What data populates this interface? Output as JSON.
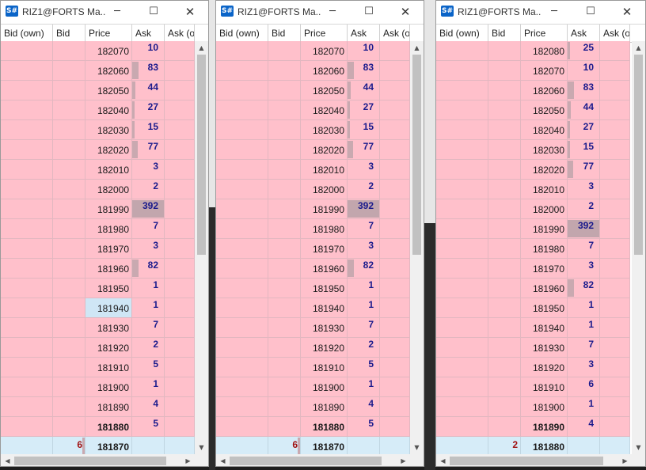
{
  "windows": [
    {
      "title": "RIZ1@FORTS Ma...",
      "columns": [
        "Bid (own)",
        "Bid",
        "Price",
        "Ask",
        "Ask (o"
      ],
      "rows": [
        {
          "price": "182070",
          "ask": "10",
          "askbar": 0
        },
        {
          "price": "182060",
          "ask": "83",
          "askbar": 0.19
        },
        {
          "price": "182050",
          "ask": "44",
          "askbar": 0.1
        },
        {
          "price": "182040",
          "ask": "27",
          "askbar": 0.06
        },
        {
          "price": "182030",
          "ask": "15",
          "askbar": 0.04
        },
        {
          "price": "182020",
          "ask": "77",
          "askbar": 0.18
        },
        {
          "price": "182010",
          "ask": "3",
          "askbar": 0
        },
        {
          "price": "182000",
          "ask": "2",
          "askbar": 0
        },
        {
          "price": "181990",
          "ask": "392",
          "askbar": 1
        },
        {
          "price": "181980",
          "ask": "7",
          "askbar": 0
        },
        {
          "price": "181970",
          "ask": "3",
          "askbar": 0
        },
        {
          "price": "181960",
          "ask": "82",
          "askbar": 0.2
        },
        {
          "price": "181950",
          "ask": "1",
          "askbar": 0
        },
        {
          "price": "181940",
          "ask": "1",
          "askbar": 0,
          "highlight": true
        },
        {
          "price": "181930",
          "ask": "7",
          "askbar": 0
        },
        {
          "price": "181920",
          "ask": "2",
          "askbar": 0
        },
        {
          "price": "181910",
          "ask": "5",
          "askbar": 0
        },
        {
          "price": "181900",
          "ask": "1",
          "askbar": 0
        },
        {
          "price": "181890",
          "ask": "4",
          "askbar": 0
        },
        {
          "price": "181880",
          "ask": "5",
          "askbar": 0,
          "bold": true
        },
        {
          "price": "181870",
          "bid": "6",
          "bidbar": 0.05,
          "bold": true,
          "last": true
        }
      ]
    },
    {
      "title": "RIZ1@FORTS Ma...",
      "columns": [
        "Bid (own)",
        "Bid",
        "Price",
        "Ask",
        "Ask (o"
      ],
      "rows": [
        {
          "price": "182070",
          "ask": "10",
          "askbar": 0
        },
        {
          "price": "182060",
          "ask": "83",
          "askbar": 0.19
        },
        {
          "price": "182050",
          "ask": "44",
          "askbar": 0.1
        },
        {
          "price": "182040",
          "ask": "27",
          "askbar": 0.06
        },
        {
          "price": "182030",
          "ask": "15",
          "askbar": 0.04
        },
        {
          "price": "182020",
          "ask": "77",
          "askbar": 0.18
        },
        {
          "price": "182010",
          "ask": "3",
          "askbar": 0
        },
        {
          "price": "182000",
          "ask": "2",
          "askbar": 0
        },
        {
          "price": "181990",
          "ask": "392",
          "askbar": 1
        },
        {
          "price": "181980",
          "ask": "7",
          "askbar": 0
        },
        {
          "price": "181970",
          "ask": "3",
          "askbar": 0
        },
        {
          "price": "181960",
          "ask": "82",
          "askbar": 0.2
        },
        {
          "price": "181950",
          "ask": "1",
          "askbar": 0
        },
        {
          "price": "181940",
          "ask": "1",
          "askbar": 0
        },
        {
          "price": "181930",
          "ask": "7",
          "askbar": 0
        },
        {
          "price": "181920",
          "ask": "2",
          "askbar": 0
        },
        {
          "price": "181910",
          "ask": "5",
          "askbar": 0
        },
        {
          "price": "181900",
          "ask": "1",
          "askbar": 0
        },
        {
          "price": "181890",
          "ask": "4",
          "askbar": 0
        },
        {
          "price": "181880",
          "ask": "5",
          "askbar": 0,
          "bold": true
        },
        {
          "price": "181870",
          "bid": "6",
          "bidbar": 0.05,
          "bold": true,
          "last": true
        }
      ]
    },
    {
      "title": "RIZ1@FORTS Ma...",
      "columns": [
        "Bid (own)",
        "Bid",
        "Price",
        "Ask",
        "Ask (o"
      ],
      "rows": [
        {
          "price": "182080",
          "ask": "25",
          "askbar": 0.07
        },
        {
          "price": "182070",
          "ask": "10",
          "askbar": 0
        },
        {
          "price": "182060",
          "ask": "83",
          "askbar": 0.19
        },
        {
          "price": "182050",
          "ask": "44",
          "askbar": 0.1
        },
        {
          "price": "182040",
          "ask": "27",
          "askbar": 0.06
        },
        {
          "price": "182030",
          "ask": "15",
          "askbar": 0.04
        },
        {
          "price": "182020",
          "ask": "77",
          "askbar": 0.18
        },
        {
          "price": "182010",
          "ask": "3",
          "askbar": 0
        },
        {
          "price": "182000",
          "ask": "2",
          "askbar": 0
        },
        {
          "price": "181990",
          "ask": "392",
          "askbar": 1
        },
        {
          "price": "181980",
          "ask": "7",
          "askbar": 0
        },
        {
          "price": "181970",
          "ask": "3",
          "askbar": 0
        },
        {
          "price": "181960",
          "ask": "82",
          "askbar": 0.2
        },
        {
          "price": "181950",
          "ask": "1",
          "askbar": 0
        },
        {
          "price": "181940",
          "ask": "1",
          "askbar": 0
        },
        {
          "price": "181930",
          "ask": "7",
          "askbar": 0
        },
        {
          "price": "181920",
          "ask": "3",
          "askbar": 0
        },
        {
          "price": "181910",
          "ask": "6",
          "askbar": 0
        },
        {
          "price": "181900",
          "ask": "1",
          "askbar": 0
        },
        {
          "price": "181890",
          "ask": "4",
          "askbar": 0,
          "bold": true
        },
        {
          "price": "181880",
          "bid": "2",
          "bidbar": 0,
          "bold": true,
          "last": true
        }
      ]
    }
  ],
  "icons": {
    "app": "app-logo-icon",
    "minimize": "minimize-icon",
    "maximize": "maximize-icon",
    "close": "close-icon"
  },
  "glyphs": {
    "app": "S#",
    "minimize": "─",
    "maximize": "☐",
    "close": "✕",
    "up": "▲",
    "down": "▼",
    "left": "◀",
    "right": "▶"
  },
  "colors": {
    "pink": "#ffc0cb",
    "highlight": "#cfe6f5",
    "ask_text": "#1a1a8c",
    "bid_text": "#a01010",
    "volume_bar": "#c9a9b0"
  }
}
